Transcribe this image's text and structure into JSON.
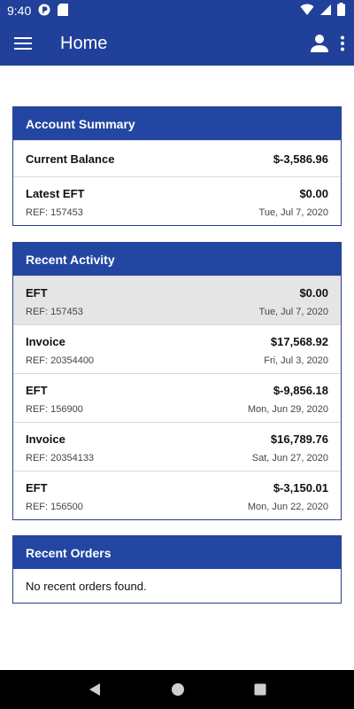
{
  "status_bar": {
    "time": "9:40"
  },
  "app_bar": {
    "title": "Home"
  },
  "account_summary": {
    "header": "Account Summary",
    "current_balance": {
      "label": "Current Balance",
      "amount": "$-3,586.96"
    },
    "latest_eft": {
      "label": "Latest EFT",
      "amount": "$0.00",
      "ref": "REF: 157453",
      "date": "Tue, Jul 7, 2020"
    }
  },
  "recent_activity": {
    "header": "Recent Activity",
    "items": [
      {
        "type": "EFT",
        "amount": "$0.00",
        "ref": "REF: 157453",
        "date": "Tue, Jul 7, 2020"
      },
      {
        "type": "Invoice",
        "amount": "$17,568.92",
        "ref": "REF: 20354400",
        "date": "Fri, Jul 3, 2020"
      },
      {
        "type": "EFT",
        "amount": "$-9,856.18",
        "ref": "REF: 156900",
        "date": "Mon, Jun 29, 2020"
      },
      {
        "type": "Invoice",
        "amount": "$16,789.76",
        "ref": "REF: 20354133",
        "date": "Sat, Jun 27, 2020"
      },
      {
        "type": "EFT",
        "amount": "$-3,150.01",
        "ref": "REF: 156500",
        "date": "Mon, Jun 22, 2020"
      }
    ]
  },
  "recent_orders": {
    "header": "Recent Orders",
    "empty_message": "No recent orders found."
  },
  "colors": {
    "primary": "#20409a",
    "card_header": "#2346a3",
    "highlight_row": "#e5e5e5"
  }
}
